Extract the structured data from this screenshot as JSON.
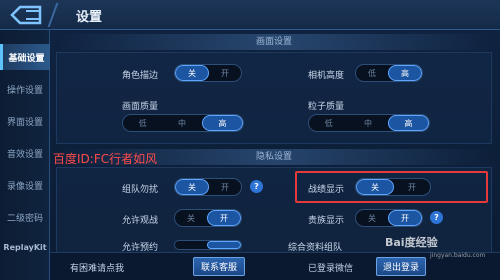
{
  "header": {
    "title": "设置"
  },
  "sidebar": {
    "items": [
      {
        "label": "基础设置"
      },
      {
        "label": "操作设置"
      },
      {
        "label": "界面设置"
      },
      {
        "label": "音效设置"
      },
      {
        "label": "录像设置"
      },
      {
        "label": "二级密码"
      },
      {
        "label": "ReplayKit"
      }
    ],
    "active_index": 0
  },
  "display": {
    "section_title": "画面设置",
    "character_outline": {
      "label": "角色描边",
      "options": [
        "关",
        "开"
      ],
      "selected": "关"
    },
    "camera_height": {
      "label": "相机高度",
      "options": [
        "低",
        "高"
      ],
      "selected": "高"
    },
    "graphics_quality": {
      "label": "画面质量",
      "options": [
        "低",
        "中",
        "高"
      ],
      "selected": "高"
    },
    "particle_quality": {
      "label": "粒子质量",
      "options": [
        "低",
        "中",
        "高"
      ],
      "selected": "高"
    }
  },
  "privacy": {
    "section_title": "隐私设置",
    "team_dnd": {
      "label": "组队勿扰",
      "options": [
        "关",
        "开"
      ],
      "selected": "关",
      "help": "?"
    },
    "record_display": {
      "label": "战绩显示",
      "options": [
        "关",
        "开"
      ],
      "selected": "关"
    },
    "allow_spectate": {
      "label": "允许观战",
      "options": [
        "关",
        "开"
      ],
      "selected": "开"
    },
    "noble_display": {
      "label": "贵族显示",
      "options": [
        "关",
        "开"
      ],
      "selected": "开",
      "help": "?"
    },
    "row5_left_label": "允许预约",
    "row5_right_label": "综合资料组队"
  },
  "overlay": {
    "watermark_text": "百度ID:FC行者如风"
  },
  "footer": {
    "question_text": "有困难请点我",
    "support_button": "联系客服",
    "login_status": "已登录微信",
    "logout_button": "退出登录"
  },
  "baidu_watermark": {
    "text": "Bai度经验",
    "sub": "jingyan.baidu.com"
  },
  "colors": {
    "accent": "#1c56a3",
    "highlight": "#e5393a",
    "watermark": "#ff4b4b"
  }
}
